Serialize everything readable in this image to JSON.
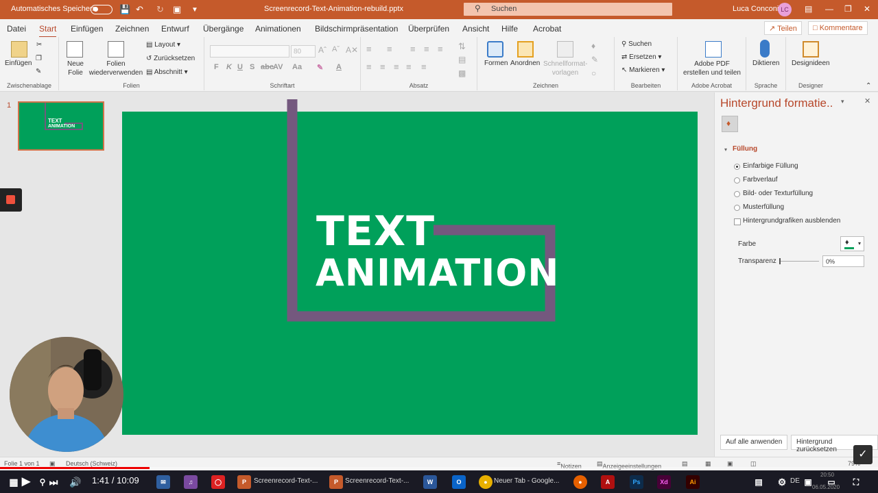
{
  "titlebar": {
    "autosave_label": "Automatisches Speichern",
    "document_title": "Screenrecord-Text-Animation-rebuild.pptx",
    "search_label": "Suchen",
    "user_name": "Luca Conconi",
    "avatar_initials": "LC",
    "bg_color": "#c55a2b"
  },
  "menu": {
    "tabs": [
      "Datei",
      "Start",
      "Einfügen",
      "Zeichnen",
      "Entwurf",
      "Übergänge",
      "Animationen",
      "Bildschirmpräsentation",
      "Überprüfen",
      "Ansicht",
      "Hilfe",
      "Acrobat"
    ],
    "active_tab": "Start",
    "share_label": "Teilen",
    "comments_label": "Kommentare"
  },
  "ribbon": {
    "clipboard": {
      "paste_label": "Einfügen",
      "group_name": "Zwischenablage"
    },
    "slides": {
      "new_slide_label": "Neue Folie",
      "reuse_label": "Folien wiederverwenden",
      "layout_label": "Layout",
      "reset_label": "Zurücksetzen",
      "section_label": "Abschnitt",
      "group_name": "Folien"
    },
    "font": {
      "group_name": "Schriftart",
      "size_placeholder": "80"
    },
    "paragraph": {
      "group_name": "Absatz"
    },
    "drawing": {
      "shapes_label": "Formen",
      "arrange_label": "Anordnen",
      "quickstyles_label": "Schnellformat-vorlagen",
      "group_name": "Zeichnen"
    },
    "editing": {
      "find_label": "Suchen",
      "replace_label": "Ersetzen",
      "select_label": "Markieren",
      "group_name": "Bearbeiten"
    },
    "acrobat": {
      "label": "Adobe PDF erstellen und teilen",
      "group_name": "Adobe Acrobat"
    },
    "voice": {
      "label": "Diktieren",
      "group_name": "Sprache"
    },
    "designer": {
      "label": "Designideen",
      "group_name": "Designer"
    }
  },
  "thumbnails": {
    "slide_number": "1",
    "thumb_line1": "TEXT",
    "thumb_line2": "ANIMATION"
  },
  "slide": {
    "line1": "TEXT",
    "line2": "ANIMATION",
    "background_color": "#00a05a",
    "outline_color": "#74587e"
  },
  "format_pane": {
    "title": "Hintergrund formatie..",
    "section_fill": "Füllung",
    "options": [
      "Einfarbige Füllung",
      "Farbverlauf",
      "Bild- oder Texturfüllung",
      "Musterfüllung"
    ],
    "selected_option": "Einfarbige Füllung",
    "hide_graphics_label": "Hintergrundgrafiken ausblenden",
    "color_label": "Farbe",
    "transparency_label": "Transparenz",
    "transparency_value": "0%",
    "apply_all_label": "Auf alle anwenden",
    "reset_label": "Hintergrund zurücksetzen"
  },
  "statusbar": {
    "slide_info": "Folie 1 von 1",
    "language": "Deutsch (Schweiz)",
    "notes_label": "Notizen",
    "display_label": "Anzeigeeinstellungen",
    "zoom": "79%"
  },
  "video": {
    "timecode": "1:41 / 10:09",
    "progress_fraction": 0.17
  },
  "taskbar": {
    "items": [
      "Screenrecord-Text-...",
      "Screenrecord-Text-...",
      "Neuer Tab - Google..."
    ],
    "lang": "DE",
    "time": "20:50",
    "date": "06.05.2020"
  }
}
